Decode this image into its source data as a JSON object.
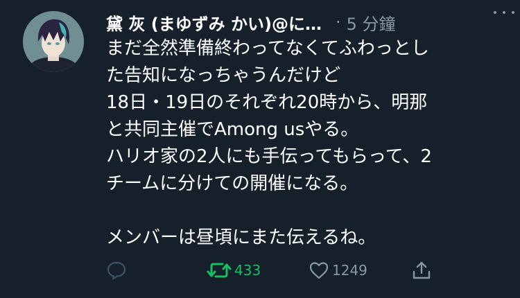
{
  "author": {
    "display_name": "黛 灰 (まゆずみ かい)@に…",
    "avatar_icon": "avatar-image"
  },
  "meta": {
    "separator": "·",
    "timestamp": "5 分鐘",
    "more_icon": "more-icon"
  },
  "tweet": {
    "lines": [
      "まだ全然準備終わってなくてふわっとし",
      "た告知になっちゃうんだけど",
      "18日・19日のそれぞれ20時から、明那",
      "と共同主催でAmong usやる。",
      "ハリオ家の2人にも手伝ってもらって、2",
      "チームに分けての開催になる。",
      "",
      "メンバーは昼頃にまた伝えるね。"
    ]
  },
  "actions": {
    "reply": {
      "icon": "reply-icon",
      "count": ""
    },
    "retweet": {
      "icon": "retweet-icon",
      "count": "433",
      "active_color": "#17bf63"
    },
    "like": {
      "icon": "heart-icon",
      "count": "1249"
    },
    "share": {
      "icon": "share-icon"
    }
  },
  "colors": {
    "background": "#15202b",
    "secondary_text": "#8899a6",
    "retweet_active": "#17bf63"
  }
}
